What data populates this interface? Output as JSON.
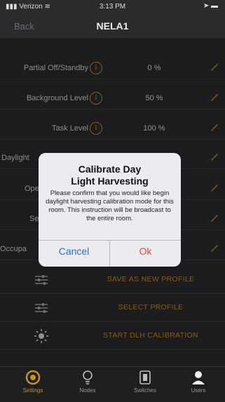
{
  "status_bar": {
    "carrier": "Verizon",
    "time": "3:13 PM"
  },
  "nav": {
    "back_label": "Back",
    "title": "NELA1"
  },
  "settings_rows": [
    {
      "label": "Partial Off/Standby",
      "value": "0 %"
    },
    {
      "label": "Background Level",
      "value": "50 %"
    },
    {
      "label": "Task Level",
      "value": "100 %"
    },
    {
      "label": "Daylight",
      "value": ""
    },
    {
      "label": "Opera",
      "value": ""
    },
    {
      "label": "Se",
      "value": ""
    },
    {
      "label": "Occupa",
      "value": ""
    }
  ],
  "actions": [
    {
      "label": "SAVE AS NEW PROFILE",
      "icon": "sliders-icon"
    },
    {
      "label": "SELECT PROFILE",
      "icon": "sliders-icon"
    },
    {
      "label": "START DLH CALIBRATION",
      "icon": "sun-icon"
    }
  ],
  "dialog": {
    "title_line1": "Calibrate Day",
    "title_line2": "Light Harvesting",
    "message": "Please confirm that you would like begin daylight harvesting calibration mode for this room. This instruction will be broadcast to the entire room.",
    "cancel_label": "Cancel",
    "ok_label": "Ok"
  },
  "tabs": [
    {
      "label": "Settings",
      "active": true
    },
    {
      "label": "Nodes",
      "active": false
    },
    {
      "label": "Switches",
      "active": false
    },
    {
      "label": "Users",
      "active": false
    }
  ],
  "colors": {
    "accent": "#c8901f",
    "background": "#2b2b2e",
    "cancel": "#1a73e8",
    "ok": "#e0453a"
  }
}
